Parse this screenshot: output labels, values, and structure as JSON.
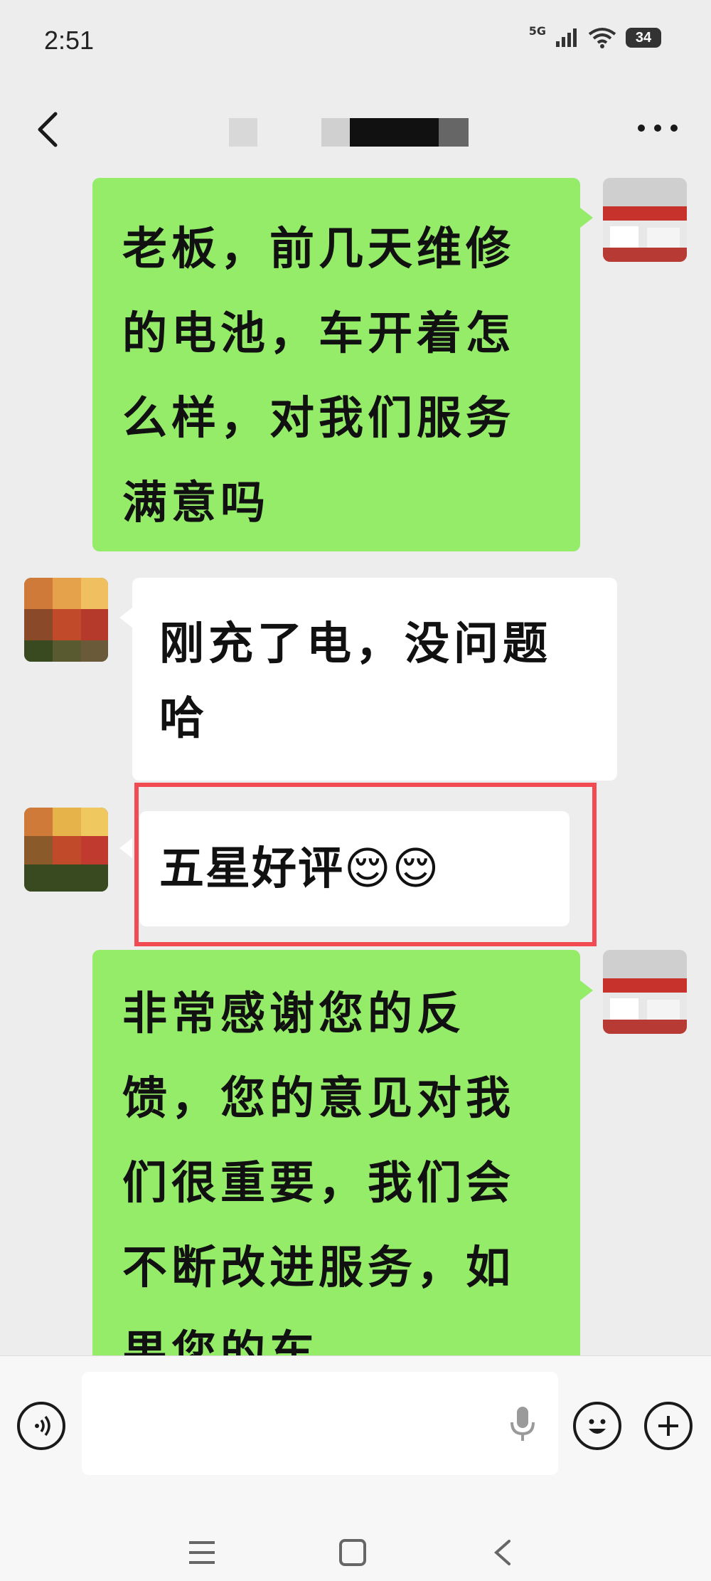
{
  "status_bar": {
    "time": "2:51",
    "network": "5G",
    "battery": "34"
  },
  "header": {
    "title": ""
  },
  "messages": [
    {
      "sender": "me",
      "text": "老板，前几天维修的电池，车开着怎么样，对我们服务满意吗"
    },
    {
      "sender": "other",
      "text": "刚充了电，没问题哈"
    },
    {
      "sender": "other",
      "text": "五星好评😌😌",
      "highlighted": true
    },
    {
      "sender": "me",
      "text": "非常感谢您的反馈，您的意见对我们很重要，我们会不断改进服务，如果您的车"
    }
  ],
  "colors": {
    "my_bubble": "#95ec69",
    "other_bubble": "#ffffff",
    "highlight_border": "#f24a52",
    "background": "#ededed"
  },
  "icons": {
    "voice_toggle": "voice-icon",
    "microphone": "microphone-icon",
    "emoji": "emoji-icon",
    "more": "plus-icon"
  }
}
